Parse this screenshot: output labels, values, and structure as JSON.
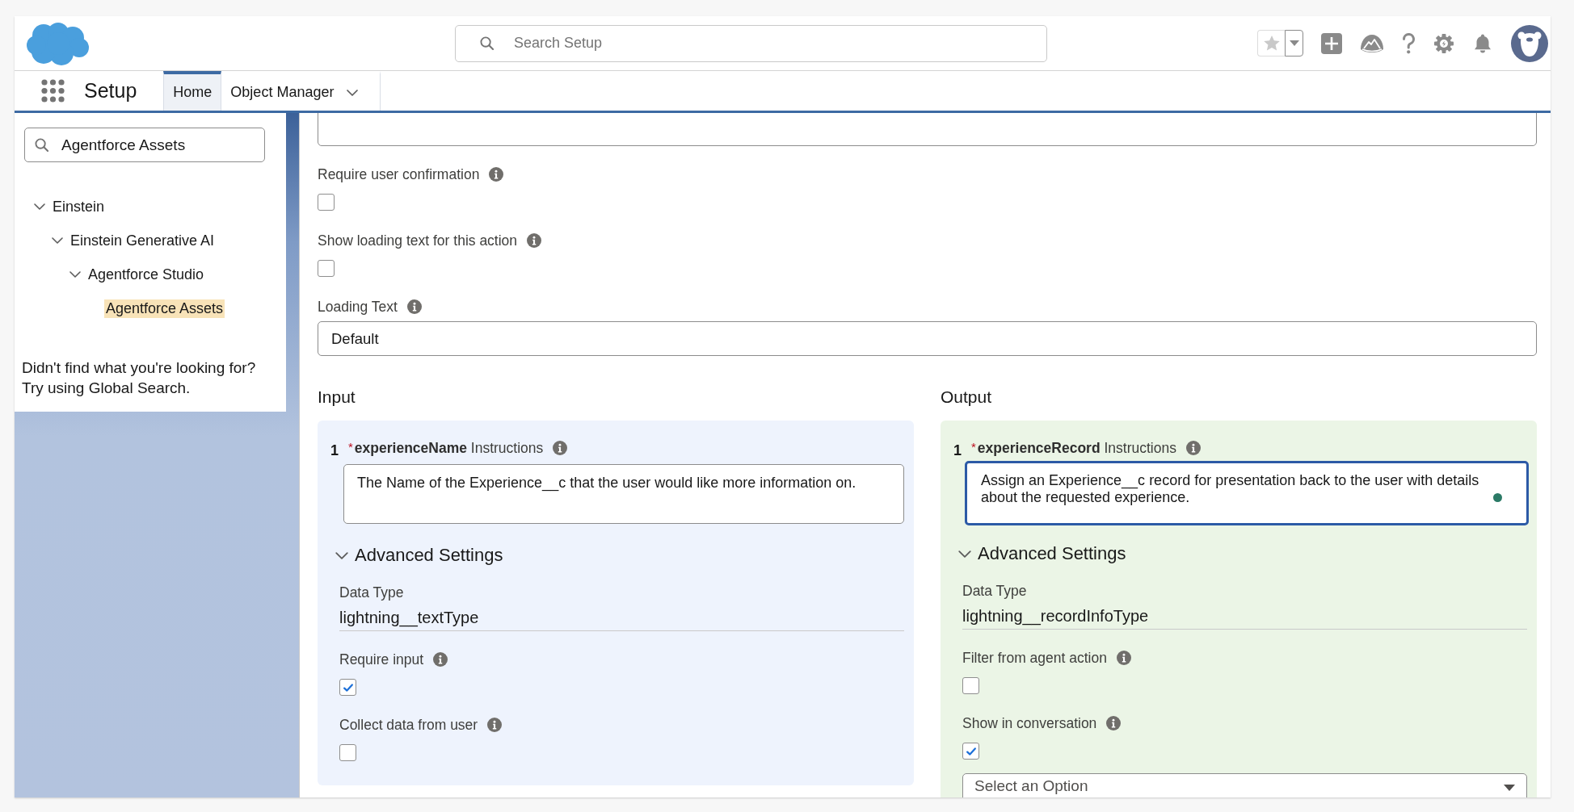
{
  "header": {
    "search": {
      "placeholder": "Search Setup"
    }
  },
  "nav": {
    "app_name": "Setup",
    "tabs": [
      {
        "label": "Home",
        "selected": true,
        "menu": false
      },
      {
        "label": "Object Manager",
        "selected": false,
        "menu": true
      }
    ]
  },
  "sidebar": {
    "quick_find": {
      "value": "Agentforce Assets"
    },
    "tree": [
      {
        "label": "Einstein",
        "expanded": true,
        "selected": false,
        "children": [
          {
            "label": "Einstein Generative AI",
            "expanded": true,
            "selected": false,
            "children": [
              {
                "label": "Agentforce Studio",
                "expanded": true,
                "selected": false,
                "children": [
                  {
                    "label": "Agentforce Assets",
                    "selected": true
                  }
                ]
              }
            ]
          }
        ]
      }
    ],
    "hint": [
      "Didn't find what you're looking for?",
      "Try using Global Search."
    ]
  },
  "action_settings": [
    {
      "kind": "textarea"
    },
    {
      "kind": "checkbox",
      "label": "Require user confirmation",
      "info": true,
      "checked": false
    },
    {
      "kind": "checkbox",
      "label": "Show loading text for this action",
      "info": true,
      "checked": false
    },
    {
      "kind": "text",
      "label": "Loading Text",
      "info": true,
      "value": "Default"
    }
  ],
  "parameters": [
    {
      "heading": "Input",
      "color": "#eef3fd",
      "number": "1",
      "required_mark": "*",
      "label": "**experienceName** Instructions",
      "info": true,
      "instructions": "The Name of the Experience__c that the user would like more information on.",
      "focused": false,
      "indicator": false,
      "advanced": {
        "label": "Advanced Settings",
        "expanded": true
      },
      "data_type": {
        "label": "Data Type",
        "value": "lightning__textType"
      },
      "options": [
        {
          "label": "Require input",
          "info": true,
          "checked": true
        },
        {
          "label": "Collect data from user",
          "info": true,
          "checked": false
        }
      ]
    },
    {
      "heading": "Output",
      "color": "#ebf5e6",
      "number": "1",
      "required_mark": "*",
      "label": "**experienceRecord** Instructions",
      "info": true,
      "instructions": "Assign an Experience__c record for presentation back to the user with details about the requested experience.",
      "focused": true,
      "indicator": true,
      "advanced": {
        "label": "Advanced Settings",
        "expanded": true
      },
      "data_type": {
        "label": "Data Type",
        "value": "lightning__recordInfoType"
      },
      "options": [
        {
          "label": "Filter from agent action",
          "info": true,
          "checked": false
        },
        {
          "label": "Show in conversation",
          "info": true,
          "checked": true
        }
      ],
      "dropdown": {
        "placeholder": "Select an Option"
      }
    }
  ]
}
